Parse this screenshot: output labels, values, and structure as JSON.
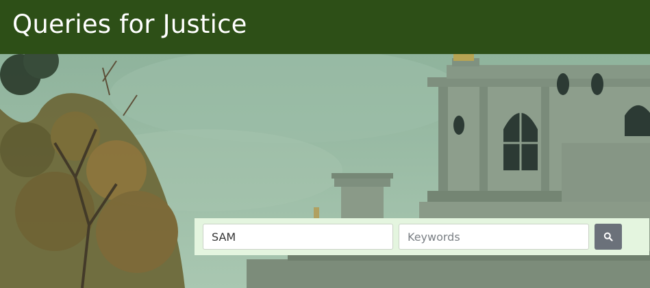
{
  "header": {
    "title": "Queries for Justice",
    "background": "#2d4f17"
  },
  "search": {
    "name_value": "SAM",
    "keywords_placeholder": "Keywords",
    "button_icon": "search-icon",
    "panel_color": "#e4f5df",
    "button_color": "#6b717a"
  },
  "hero": {
    "subject": "courthouse-photo"
  }
}
